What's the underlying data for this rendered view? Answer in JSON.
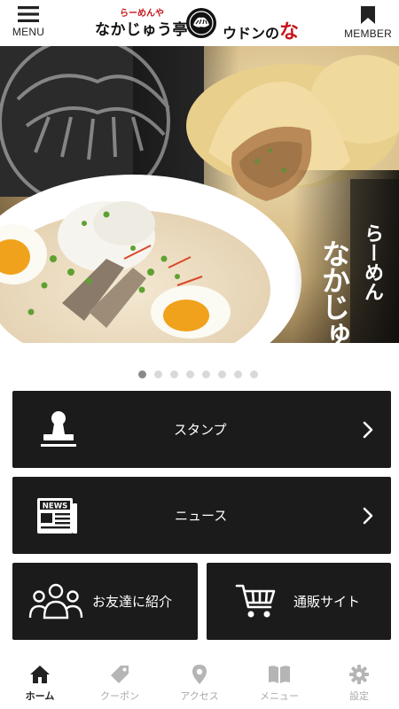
{
  "header": {
    "menu_label": "MENU",
    "member_label": "MEMBER",
    "brand_sub": "らーめんや",
    "brand_main": "なかじゅう亭",
    "brand_second": "ウドンの",
    "brand_second_red": "な"
  },
  "hero": {
    "title_small": "らーめん",
    "title_large": "なかじゅう亭",
    "slide_count": 8,
    "active_slide": 1
  },
  "menu": {
    "stamp_label": "スタンプ",
    "news_label": "ニュース",
    "news_icon_text": "NEWS",
    "friend_label": "お友達に紹介",
    "shop_label": "通販サイト"
  },
  "tabs": [
    {
      "label": "ホーム",
      "icon": "home-icon",
      "active": true
    },
    {
      "label": "クーポン",
      "icon": "tag-icon",
      "active": false
    },
    {
      "label": "アクセス",
      "icon": "map-pin-icon",
      "active": false
    },
    {
      "label": "メニュー",
      "icon": "book-icon",
      "active": false
    },
    {
      "label": "設定",
      "icon": "gear-icon",
      "active": false
    }
  ],
  "colors": {
    "tile_bg": "#1b1b1b",
    "brand_red": "#c8161d",
    "tab_active": "#222222",
    "tab_inactive": "#aaaaaa"
  }
}
